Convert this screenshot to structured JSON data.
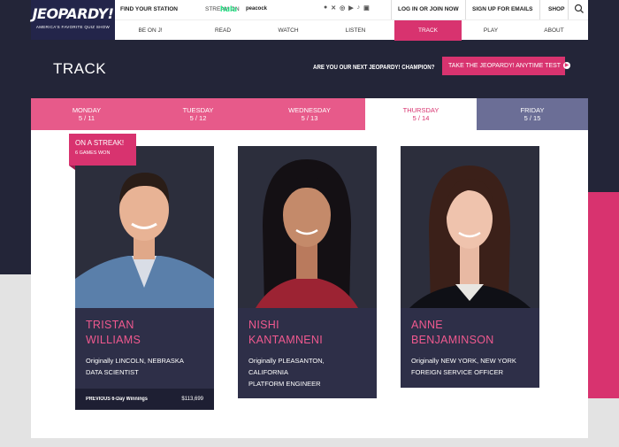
{
  "header": {
    "logo": "JEOPARDY!",
    "logo_tagline": "AMERICA'S FAVORITE QUIZ SHOW",
    "find_station": "FIND YOUR STATION",
    "stream_on": "STREAM ON",
    "hulu": "hulu",
    "peacock": "peacock",
    "login": "LOG IN  OR  JOIN NOW",
    "signup": "SIGN UP FOR EMAILS",
    "shop": "SHOP"
  },
  "nav": {
    "items": [
      {
        "label": "BE ON J!"
      },
      {
        "label": "READ"
      },
      {
        "label": "WATCH"
      },
      {
        "label": "LISTEN"
      },
      {
        "label": "TRACK"
      },
      {
        "label": "PLAY"
      },
      {
        "label": "ABOUT"
      }
    ],
    "active": "TRACK"
  },
  "page": {
    "title": "TRACK",
    "champion_question": "ARE YOU OUR NEXT JEOPARDY! CHAMPION?",
    "anytime_test_label": "TAKE THE JEOPARDY! ANYTIME TEST"
  },
  "days": [
    {
      "day": "MONDAY",
      "date": "5 / 11"
    },
    {
      "day": "TUESDAY",
      "date": "5 / 12"
    },
    {
      "day": "WEDNESDAY",
      "date": "5 / 13"
    },
    {
      "day": "THURSDAY",
      "date": "5 / 14"
    },
    {
      "day": "FRIDAY",
      "date": "5 / 15"
    }
  ],
  "streak": {
    "title": "ON A STREAK!",
    "games": "6 GAMES WON"
  },
  "contestants": [
    {
      "first": "TRISTAN",
      "last": "WILLIAMS",
      "origin": "Originally LINCOLN, NEBRASKA",
      "job": "DATA SCIENTIST",
      "winnings_label": "PREVIOUS 6-Day Winnings",
      "winnings": "$113,699"
    },
    {
      "first": "NISHI",
      "last": "KANTAMNENI",
      "origin_line1": "Originally PLEASANTON,",
      "origin_line2": "CALIFORNIA",
      "job": "PLATFORM ENGINEER"
    },
    {
      "first": "ANNE",
      "last": "BENJAMINSON",
      "origin": "Originally NEW YORK, NEW YORK",
      "job": "FOREIGN SERVICE OFFICER"
    }
  ],
  "colors": {
    "brand_pink": "#d8336f",
    "navy": "#232538",
    "slate": "#6b6e96"
  }
}
